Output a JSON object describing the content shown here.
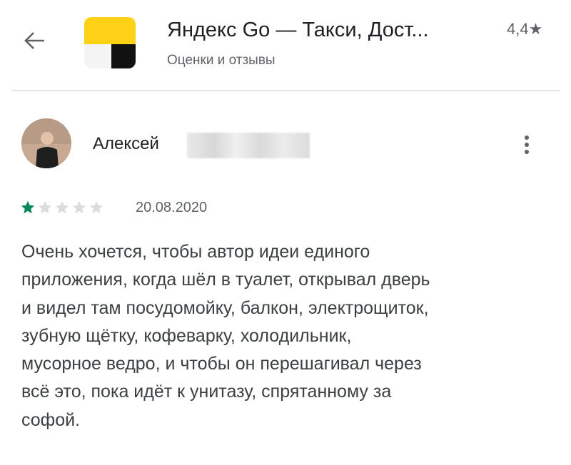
{
  "header": {
    "app_title": "Яндекс Go — Такси, Дост...",
    "subtitle": "Оценки и отзывы",
    "rating": "4,4★"
  },
  "review": {
    "author": "Алексей",
    "stars_filled": 1,
    "stars_total": 5,
    "date": "20.08.2020",
    "text_lines": [
      "Очень хочется, чтобы автор идеи единого",
      "приложения, когда шёл в туалет, открывал дверь",
      "и видел там посудомойку, балкон, электрощиток,",
      "зубную щётку, кофеварку, холодильник,",
      "мусорное ведро, и чтобы он перешагивал через",
      "всё это, пока идёт к унитазу, спрятанному за",
      "софой."
    ]
  },
  "icons": {
    "back": "arrow-left-icon",
    "app": "yandex-go-app-icon",
    "more": "more-vert-icon",
    "star": "star-icon"
  },
  "colors": {
    "star_filled": "#01875f",
    "star_empty": "#dadce0",
    "app_icon_yellow": "#fcd116",
    "app_icon_black": "#111111"
  }
}
